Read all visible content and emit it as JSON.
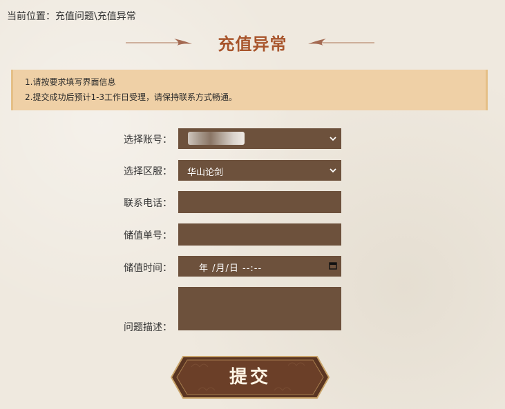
{
  "breadcrumb": "当前位置：充值问题\\充值异常",
  "page_title": "充值异常",
  "notice": {
    "line1": "1.请按要求填写界面信息",
    "line2": "2.提交成功后预计1-3工作日受理，请保持联系方式畅通。"
  },
  "form": {
    "account_label": "选择账号：",
    "account_value": "",
    "server_label": "选择区服：",
    "server_value": "华山论剑",
    "phone_label": "联系电话：",
    "phone_value": "",
    "order_label": "储值单号：",
    "order_value": "",
    "time_label": "储值时间：",
    "time_placeholder": "年 /月/日 --:--",
    "desc_label": "问题描述：",
    "desc_value": ""
  },
  "submit_label": "提交",
  "colors": {
    "field_bg": "#6d513c",
    "title": "#a8552c",
    "notice_bg": "#efd0a6",
    "button_bg": "#5a3522"
  }
}
